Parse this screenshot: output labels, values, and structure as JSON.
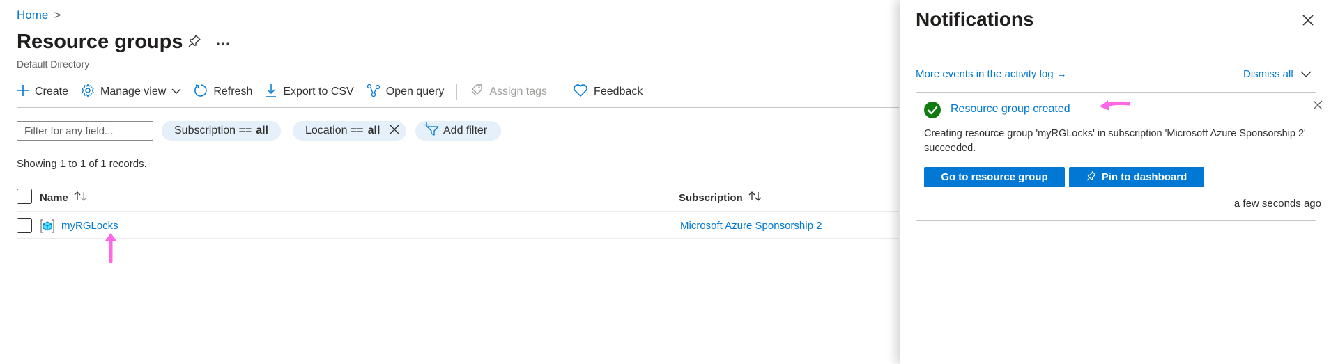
{
  "breadcrumb": {
    "home": "Home",
    "separator": ">"
  },
  "header": {
    "title": "Resource groups",
    "subtitle": "Default Directory",
    "pin_icon": "pin-icon",
    "more_icon": "more-icon"
  },
  "toolbar": {
    "create": "Create",
    "manage_view": "Manage view",
    "refresh": "Refresh",
    "export_csv": "Export to CSV",
    "open_query": "Open query",
    "assign_tags": "Assign tags",
    "feedback": "Feedback"
  },
  "filters": {
    "placeholder": "Filter for any field...",
    "subscription_label": "Subscription ==",
    "subscription_value": "all",
    "location_label": "Location ==",
    "location_value": "all",
    "add_filter": "Add filter"
  },
  "records_text": "Showing 1 to 1 of 1 records.",
  "table": {
    "columns": [
      "Name",
      "Subscription"
    ],
    "rows": [
      {
        "name": "myRGLocks",
        "subscription": "Microsoft Azure Sponsorship 2"
      }
    ]
  },
  "notifications": {
    "title": "Notifications",
    "more_events": "More events in the activity log →",
    "dismiss_all": "Dismiss all",
    "items": [
      {
        "title": "Resource group created",
        "body": "Creating resource group 'myRGLocks' in subscription 'Microsoft Azure Sponsorship 2' succeeded.",
        "primary_action": "Go to resource group",
        "secondary_action": "Pin to dashboard",
        "time": "a few seconds ago",
        "status": "success"
      }
    ]
  },
  "colors": {
    "accent": "#0078d4",
    "success": "#107c10",
    "pill": "#e5f0fb",
    "annotation": "#ff66e8"
  }
}
